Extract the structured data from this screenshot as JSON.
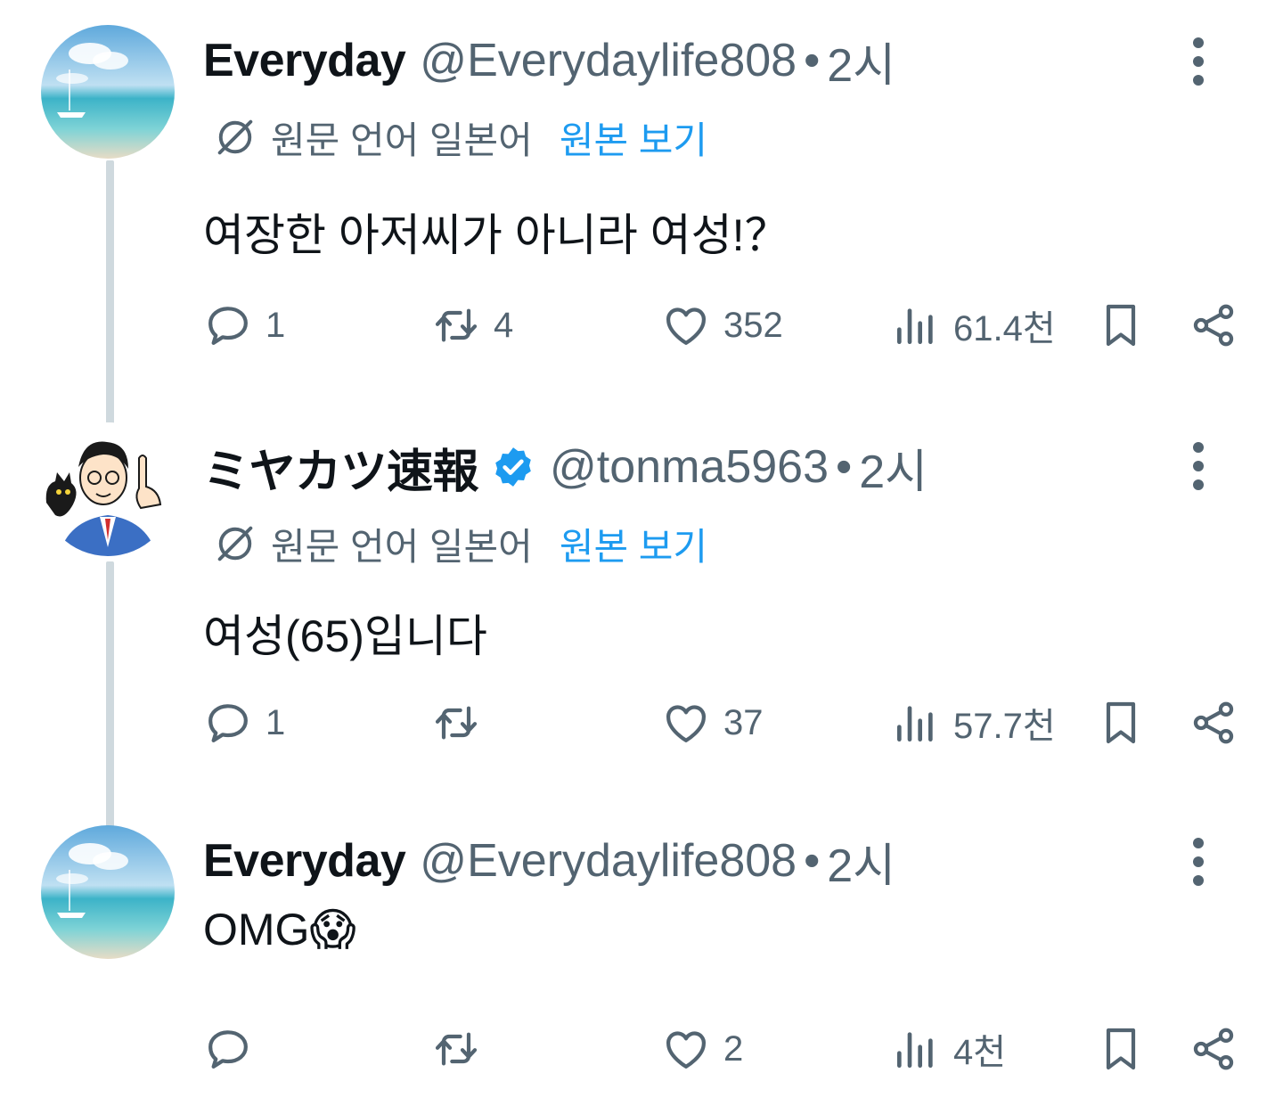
{
  "translate": {
    "label": "원문 언어 일본어",
    "link": "원본 보기"
  },
  "colors": {
    "link": "#1d9bf0",
    "muted": "#536471",
    "verified": "#1d9bf0",
    "thread_line": "#cfd9de"
  },
  "tweets": [
    {
      "name": "Everyday",
      "handle": "@Everydaylife808",
      "dot": "•",
      "time": "2시",
      "text": "여장한 아저씨가 아니라 여성!？",
      "reply_count": "1",
      "retweet_count": "4",
      "like_count": "352",
      "view_count": "61.4천"
    },
    {
      "name": "ミヤカツ速報",
      "handle": "@tonma5963",
      "dot": "•",
      "time": "2시",
      "verified": true,
      "text": "여성(65)입니다",
      "reply_count": "1",
      "retweet_count": "",
      "like_count": "37",
      "view_count": "57.7천"
    },
    {
      "name": "Everyday",
      "handle": "@Everydaylife808",
      "dot": "•",
      "time": "2시",
      "text": "OMG",
      "emoji": "😱",
      "reply_count": "",
      "retweet_count": "",
      "like_count": "2",
      "view_count": "4천"
    }
  ]
}
